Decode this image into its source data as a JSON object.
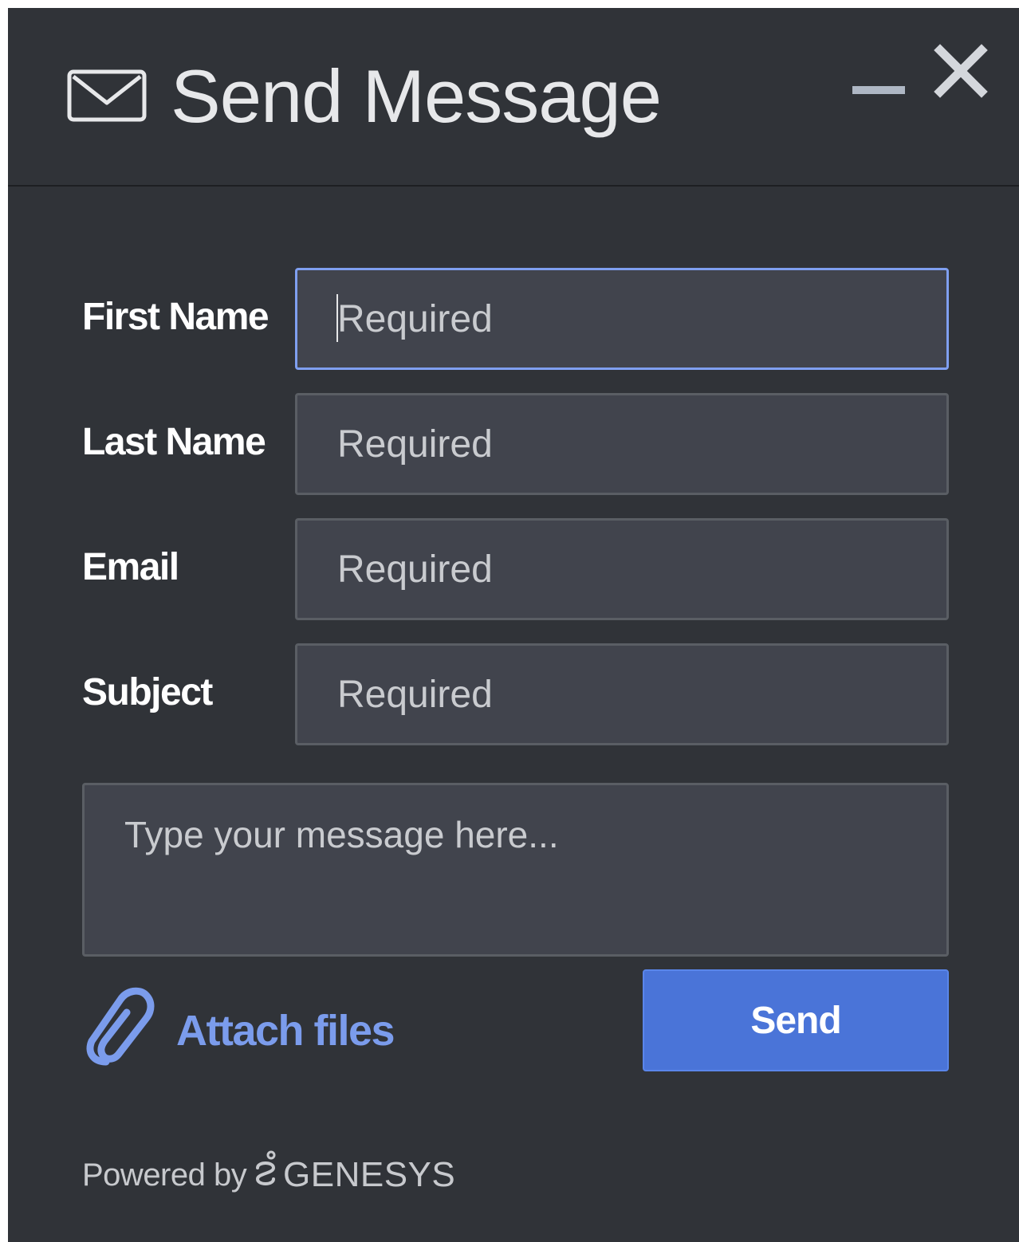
{
  "header": {
    "title": "Send Message",
    "icons": [
      "envelope-icon",
      "minimize-icon",
      "close-icon"
    ]
  },
  "form": {
    "fields": [
      {
        "label": "First Name",
        "placeholder": "Required",
        "value": "",
        "focused": true
      },
      {
        "label": "Last Name",
        "placeholder": "Required",
        "value": ""
      },
      {
        "label": "Email",
        "placeholder": "Required",
        "value": ""
      },
      {
        "label": "Subject",
        "placeholder": "Required",
        "value": ""
      }
    ],
    "message": {
      "placeholder": "Type your message here...",
      "value": ""
    }
  },
  "actions": {
    "attach_label": "Attach files",
    "attach_icon": "paperclip-icon",
    "send_label": "Send"
  },
  "footer": {
    "powered_by": "Powered by",
    "brand": "GENESYS",
    "brand_icon": "genesys-logo-icon"
  },
  "colors": {
    "background": "#303338",
    "input_background": "#41444d",
    "input_border": "#5a5e64",
    "focus_border": "#7f9ff0",
    "accent": "#4a74d8",
    "link": "#7b9cec"
  }
}
